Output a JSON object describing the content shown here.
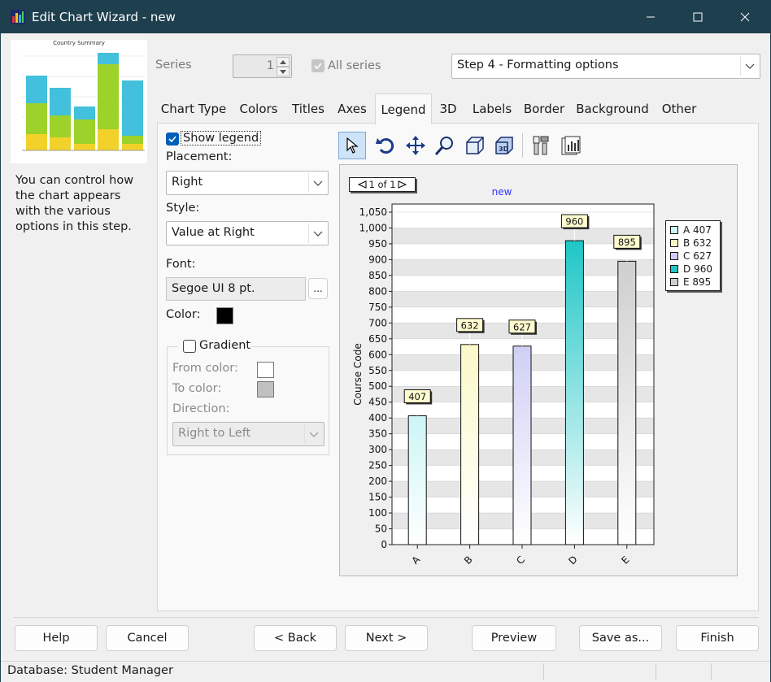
{
  "window": {
    "title": "Edit Chart Wizard - new"
  },
  "preview": {
    "thumb_title": "Country Summary"
  },
  "description": "You can control how the chart appears with the various options in this step.",
  "series": {
    "label": "Series",
    "value": "1",
    "all_series_label": "All series"
  },
  "step": {
    "selected": "Step 4 - Formatting options"
  },
  "tabs": [
    "Chart Type",
    "Colors",
    "Titles",
    "Axes",
    "Legend",
    "3D",
    "Labels",
    "Border",
    "Background",
    "Other"
  ],
  "active_tab": "Legend",
  "legend": {
    "show_legend_label": "Show legend",
    "show_legend_checked": true,
    "placement_label": "Placement:",
    "placement_value": "Right",
    "style_label": "Style:",
    "style_value": "Value at Right",
    "font_label": "Font:",
    "font_value": "Segoe UI 8 pt.",
    "font_button": "...",
    "color_label": "Color:",
    "color_value": "#000000",
    "gradient_label": "Gradient",
    "from_color_label": "From color:",
    "from_color_value": "#ffffff",
    "to_color_label": "To color:",
    "to_color_value": "#c0c0c0",
    "direction_label": "Direction:",
    "direction_value": "Right to Left"
  },
  "chart_data": {
    "type": "bar",
    "title": "new",
    "pager": "1 of 1",
    "ylabel": "Course Code",
    "xlabel": "",
    "categories": [
      "A",
      "B",
      "C",
      "D",
      "E"
    ],
    "values": [
      407,
      632,
      627,
      960,
      895
    ],
    "ylim": [
      0,
      1050
    ],
    "yticks": [
      "0",
      "50",
      "100",
      "150",
      "200",
      "250",
      "300",
      "350",
      "400",
      "450",
      "500",
      "550",
      "600",
      "650",
      "700",
      "750",
      "800",
      "850",
      "900",
      "950",
      "1,000",
      "1,050"
    ],
    "colors": [
      "#ccf5f5",
      "#fbf8c8",
      "#cfcff5",
      "#1fc6c6",
      "#cfcfcf"
    ],
    "legend": [
      "A 407",
      "B 632",
      "C 627",
      "D 960",
      "E 895"
    ],
    "legend_position": "right",
    "grid": true
  },
  "buttons": {
    "help": "Help",
    "cancel": "Cancel",
    "back": "< Back",
    "next": "Next >",
    "preview": "Preview",
    "save_as": "Save as...",
    "finish": "Finish"
  },
  "status": {
    "text": "Database: Student Manager"
  }
}
